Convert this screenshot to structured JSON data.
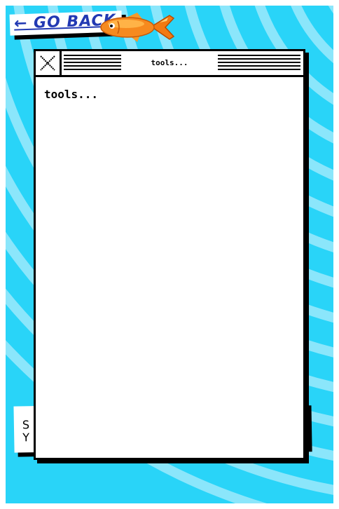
{
  "nav": {
    "back_label": "← GO BACK"
  },
  "window": {
    "title": "tools...",
    "close_icon": "x-icon"
  },
  "content": {
    "heading": "tools..."
  },
  "back_card": {
    "text": "S Y"
  },
  "colors": {
    "background": "#29d4f8",
    "swirl": "#8be6fb",
    "link": "#2239b3",
    "fish": "#f68a1f"
  }
}
